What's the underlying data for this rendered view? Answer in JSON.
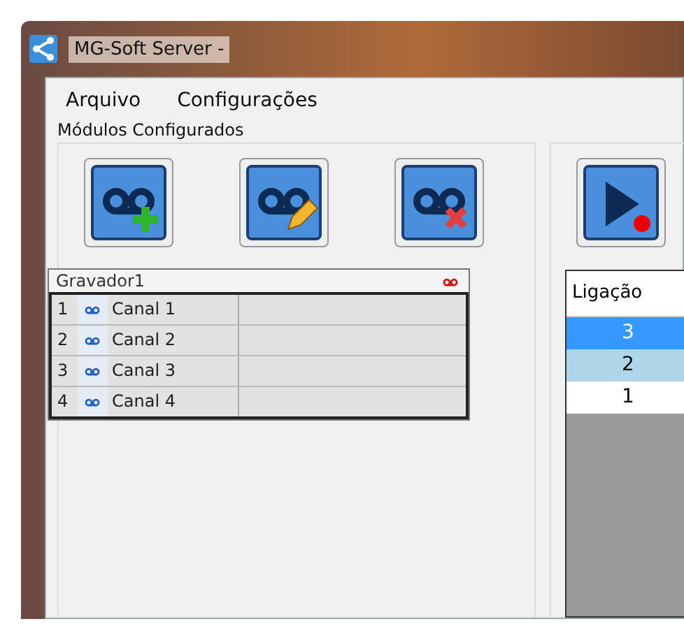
{
  "window": {
    "title": "MG-Soft Server -"
  },
  "menu": [
    {
      "label": "Arquivo"
    },
    {
      "label": "Configurações"
    }
  ],
  "modules": {
    "label": "Módulos Configurados",
    "toolbar": [
      {
        "kind": "add"
      },
      {
        "kind": "edit"
      },
      {
        "kind": "remove"
      }
    ],
    "recorder": {
      "name": "Gravador1",
      "channels": [
        {
          "number": "1",
          "name": "Canal 1"
        },
        {
          "number": "2",
          "name": "Canal 2"
        },
        {
          "number": "3",
          "name": "Canal 3"
        },
        {
          "number": "4",
          "name": "Canal 4"
        }
      ]
    }
  },
  "calls": {
    "toolbar": [
      {
        "kind": "play-record"
      }
    ],
    "columns": [
      "Ligação"
    ],
    "rows": [
      {
        "cell": "3",
        "selected": true,
        "highlighted": false
      },
      {
        "cell": "2",
        "selected": false,
        "highlighted": true
      },
      {
        "cell": "1",
        "selected": false,
        "highlighted": false
      }
    ]
  }
}
